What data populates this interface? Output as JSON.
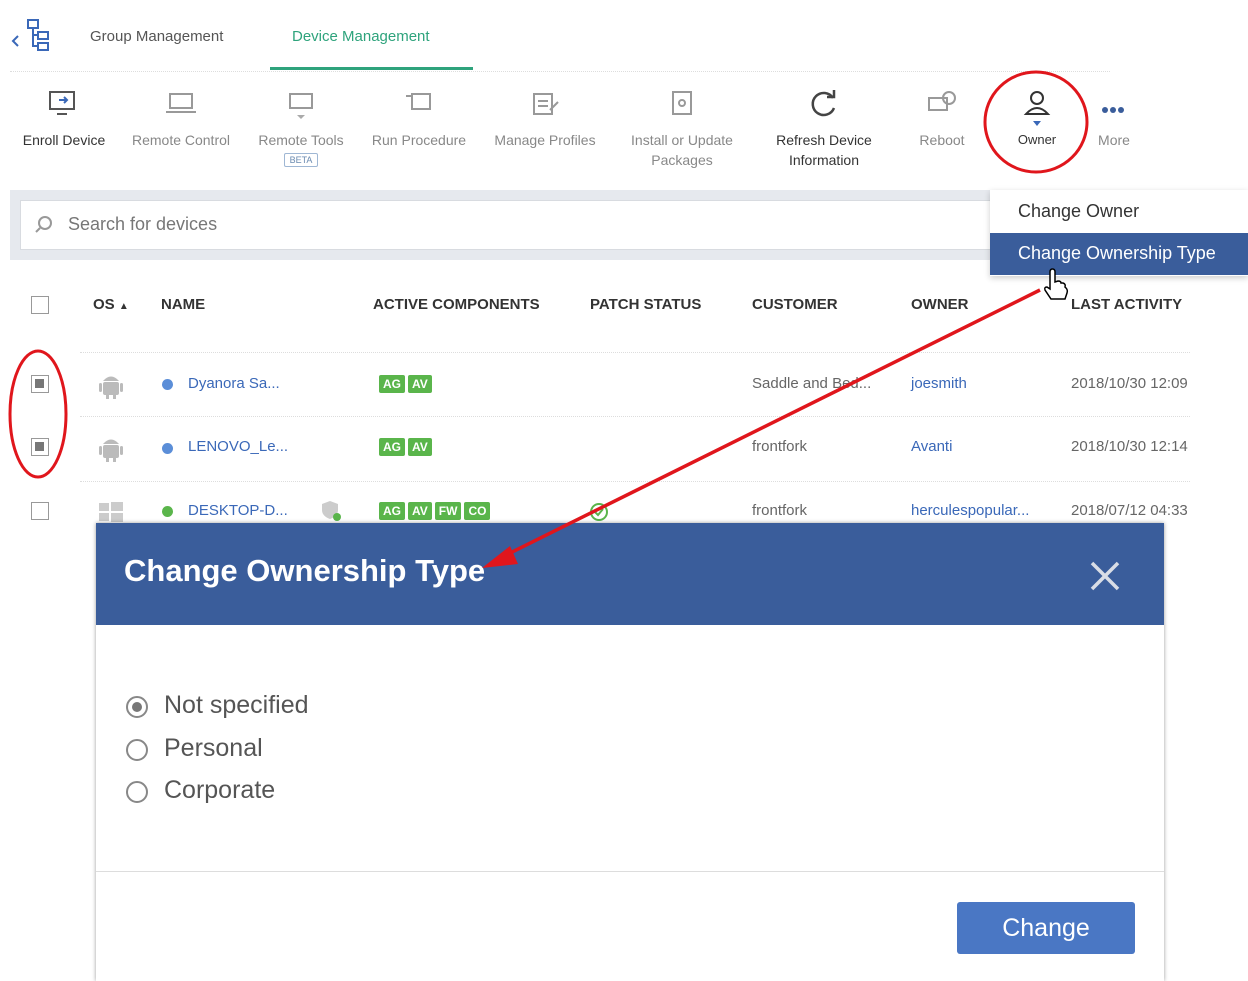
{
  "tabs": [
    {
      "label": "Group Management"
    },
    {
      "label": "Device Management"
    }
  ],
  "toolbar": {
    "enroll": "Enroll Device",
    "remote_control": "Remote Control",
    "remote_tools": "Remote Tools",
    "remote_tools_badge": "BETA",
    "run_procedure": "Run Procedure",
    "manage_profiles": "Manage Profiles",
    "install_line1": "Install or Update",
    "install_line2": "Packages",
    "refresh_line1": "Refresh Device",
    "refresh_line2": "Information",
    "reboot": "Reboot",
    "owner": "Owner",
    "more": "More"
  },
  "search": {
    "placeholder": "Search for devices"
  },
  "owner_menu": {
    "change_owner": "Change Owner",
    "change_ownership_type": "Change Ownership Type"
  },
  "table": {
    "headers": {
      "os": "OS",
      "name": "NAME",
      "active_components": "ACTIVE COMPONENTS",
      "patch_status": "PATCH STATUS",
      "customer": "CUSTOMER",
      "owner": "OWNER",
      "last_activity": "LAST ACTIVITY"
    },
    "rows": [
      {
        "name": "Dyanora Sa...",
        "badges": [
          "AG",
          "AV"
        ],
        "customer": "Saddle and Bed...",
        "owner": "joesmith",
        "last_activity": "2018/10/30 12:09",
        "checked": true
      },
      {
        "name": "LENOVO_Le...",
        "badges": [
          "AG",
          "AV"
        ],
        "customer": "frontfork",
        "owner": "Avanti",
        "last_activity": "2018/10/30 12:14",
        "checked": true
      },
      {
        "name": "DESKTOP-D...",
        "badges": [
          "AG",
          "AV",
          "FW",
          "CO"
        ],
        "customer": "frontfork",
        "owner": "herculespopular...",
        "last_activity": "2018/07/12 04:33",
        "checked": false
      }
    ]
  },
  "dialog": {
    "title": "Change Ownership Type",
    "options": [
      "Not specified",
      "Personal",
      "Corporate"
    ],
    "selected": "Not specified",
    "button": "Change"
  },
  "colors": {
    "accent_green": "#2ea37c",
    "dialog_blue": "#3a5d9b",
    "button_blue": "#4a77c4",
    "annotation_red": "#e0161c"
  }
}
